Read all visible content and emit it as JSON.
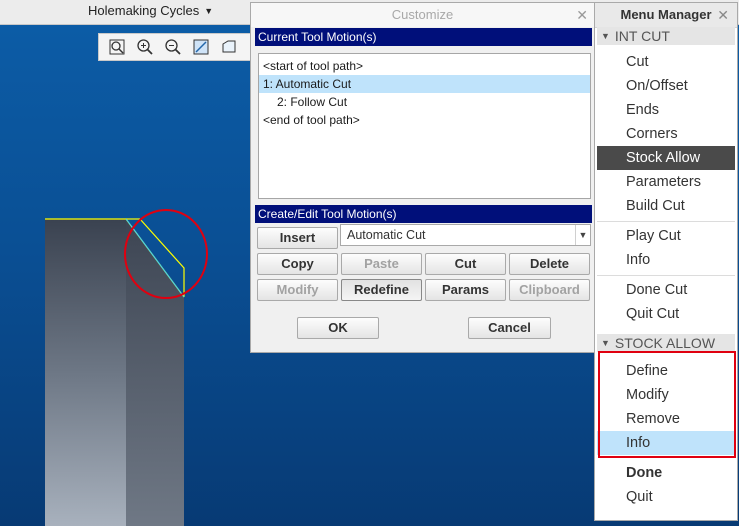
{
  "top_menu": {
    "label": "Holemaking Cycles"
  },
  "dialog": {
    "title": "Customize",
    "current_header": "Current Tool Motion(s)",
    "toolpath": [
      "<start of tool path>",
      "1: Automatic Cut",
      "2: Follow Cut",
      "<end of tool path>"
    ],
    "create_header": "Create/Edit Tool Motion(s)",
    "combo_value": "Automatic Cut",
    "buttons": {
      "insert": "Insert",
      "copy": "Copy",
      "paste": "Paste",
      "cut": "Cut",
      "delete": "Delete",
      "modify": "Modify",
      "redefine": "Redefine",
      "params": "Params",
      "clipboard": "Clipboard",
      "ok": "OK",
      "cancel": "Cancel"
    }
  },
  "menu": {
    "title": "Menu Manager",
    "sec1": "INT CUT",
    "int_cut": [
      "Cut",
      "On/Offset",
      "Ends",
      "Corners",
      "Stock Allow",
      "Parameters",
      "Build Cut",
      "Play Cut",
      "Info",
      "Done Cut",
      "Quit Cut"
    ],
    "sec2": "STOCK ALLOW",
    "stock_allow": [
      "Define",
      "Modify",
      "Remove",
      "Info",
      "Done",
      "Quit"
    ]
  },
  "colors": {
    "title_bar": "#000f7a",
    "selection": "#bfe3fb",
    "highlight_dark": "#4a4a4a",
    "annotation_red": "#e00010"
  }
}
